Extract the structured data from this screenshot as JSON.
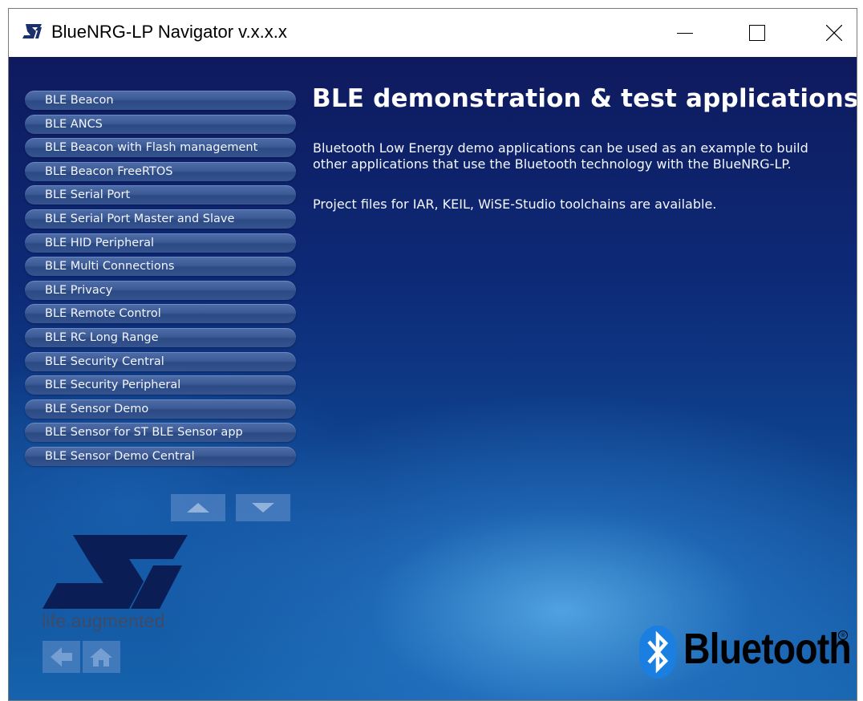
{
  "window": {
    "title": "BlueNRG-LP Navigator v.x.x.x",
    "controls": [
      "minimize-icon",
      "maximize-icon",
      "close-icon"
    ]
  },
  "menu": {
    "items": [
      {
        "label": "BLE Beacon"
      },
      {
        "label": "BLE ANCS"
      },
      {
        "label": "BLE Beacon with Flash management"
      },
      {
        "label": "BLE Beacon FreeRTOS"
      },
      {
        "label": "BLE Serial Port"
      },
      {
        "label": "BLE Serial Port Master and Slave"
      },
      {
        "label": "BLE HID Peripheral"
      },
      {
        "label": "BLE Multi Connections"
      },
      {
        "label": "BLE Privacy"
      },
      {
        "label": "BLE Remote Control"
      },
      {
        "label": "BLE RC Long Range"
      },
      {
        "label": "BLE Security Central"
      },
      {
        "label": "BLE Security Peripheral"
      },
      {
        "label": "BLE Sensor Demo"
      },
      {
        "label": "BLE Sensor for ST BLE Sensor app"
      },
      {
        "label": "BLE Sensor Demo Central"
      }
    ],
    "scroll_icons": [
      "arrow-up-icon",
      "arrow-down-icon"
    ]
  },
  "branding": {
    "st_logo": "ST",
    "tagline": "life.augmented",
    "bluetooth_word": "Bluetooth",
    "bluetooth_reg": "®"
  },
  "nav": {
    "icons": [
      "back-arrow-icon",
      "home-icon"
    ]
  },
  "content": {
    "heading": "BLE demonstration & test applications",
    "paragraph1": "Bluetooth Low Energy demo applications can be used as an example to build other applications that use the Bluetooth technology with the BlueNRG-LP.",
    "paragraph2": "Project files for IAR, KEIL, WiSE-Studio toolchains are available."
  },
  "colors": {
    "background_top": "#0f1a5e",
    "background_bottom": "#1663ad",
    "menu_button": "#3c5a95",
    "text": "#ffffff",
    "bluetooth_blue": "#1a7fe0"
  }
}
